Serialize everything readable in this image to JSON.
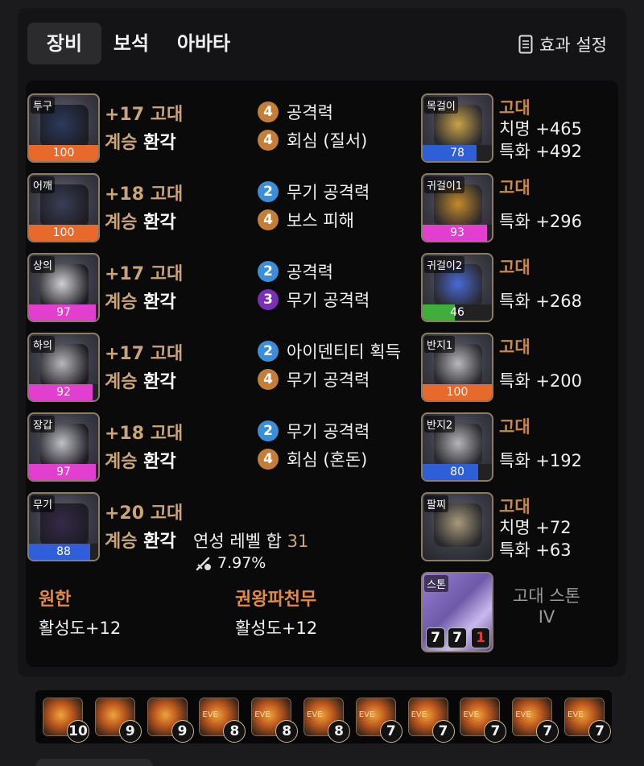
{
  "tabs": [
    "장비",
    "보석",
    "아바타"
  ],
  "effect_settings_label": "효과 설정",
  "equipment": [
    {
      "slot": "투구",
      "enhance": "+17 고대",
      "line2a": "계승",
      "line2b": "환각",
      "quality": "100",
      "quality_pct": 100,
      "quality_color": "#e8692c"
    },
    {
      "slot": "어깨",
      "enhance": "+18 고대",
      "line2a": "계승",
      "line2b": "환각",
      "quality": "100",
      "quality_pct": 100,
      "quality_color": "#e8692c"
    },
    {
      "slot": "상의",
      "enhance": "+17 고대",
      "line2a": "계승",
      "line2b": "환각",
      "quality": "97",
      "quality_pct": 97,
      "quality_color": "#e23fd0"
    },
    {
      "slot": "하의",
      "enhance": "+17 고대",
      "line2a": "계승",
      "line2b": "환각",
      "quality": "92",
      "quality_pct": 92,
      "quality_color": "#e23fd0"
    },
    {
      "slot": "장갑",
      "enhance": "+18 고대",
      "line2a": "계승",
      "line2b": "환각",
      "quality": "97",
      "quality_pct": 97,
      "quality_color": "#e23fd0"
    },
    {
      "slot": "무기",
      "enhance": "+20 고대",
      "line2a": "계승",
      "line2b": "환각",
      "quality": "88",
      "quality_pct": 88,
      "quality_color": "#2f5fd8"
    }
  ],
  "effects": [
    [
      {
        "lv": "4",
        "color": "orange",
        "name": "공격력"
      },
      {
        "lv": "4",
        "color": "orange",
        "name": "회심 (질서)"
      }
    ],
    [
      {
        "lv": "2",
        "color": "blue",
        "name": "무기 공격력"
      },
      {
        "lv": "4",
        "color": "orange",
        "name": "보스 피해"
      }
    ],
    [
      {
        "lv": "2",
        "color": "blue",
        "name": "공격력"
      },
      {
        "lv": "3",
        "color": "purple",
        "name": "무기 공격력"
      }
    ],
    [
      {
        "lv": "2",
        "color": "blue",
        "name": "아이덴티티 획득"
      },
      {
        "lv": "4",
        "color": "orange",
        "name": "무기 공격력"
      }
    ],
    [
      {
        "lv": "2",
        "color": "blue",
        "name": "무기 공격력"
      },
      {
        "lv": "4",
        "color": "orange",
        "name": "회심 (혼돈)"
      }
    ]
  ],
  "weapon_extra": {
    "level_sum_label": "연성 레벨 합",
    "level_sum_value": "31",
    "pct": "7.97%"
  },
  "accessories": [
    {
      "slot": "목걸이",
      "grade": "고대",
      "stats": [
        "치명 +465",
        "특화 +492"
      ],
      "quality": "78",
      "quality_pct": 78,
      "quality_color": "#2f5fd8"
    },
    {
      "slot": "귀걸이1",
      "grade": "고대",
      "stats": [
        "특화 +296"
      ],
      "quality": "93",
      "quality_pct": 93,
      "quality_color": "#e23fd0"
    },
    {
      "slot": "귀걸이2",
      "grade": "고대",
      "stats": [
        "특화 +268"
      ],
      "quality": "46",
      "quality_pct": 46,
      "quality_color": "#3fae3c"
    },
    {
      "slot": "반지1",
      "grade": "고대",
      "stats": [
        "특화 +200"
      ],
      "quality": "100",
      "quality_pct": 100,
      "quality_color": "#e8692c"
    },
    {
      "slot": "반지2",
      "grade": "고대",
      "stats": [
        "특화 +192"
      ],
      "quality": "80",
      "quality_pct": 80,
      "quality_color": "#2f5fd8"
    },
    {
      "slot": "팔찌",
      "grade": "고대",
      "stats": [
        "치명 +72",
        "특화 +63"
      ],
      "quality": null,
      "quality_pct": 0,
      "quality_color": ""
    }
  ],
  "stone": {
    "slot": "스톤",
    "nums": [
      "7",
      "7",
      "1"
    ],
    "label1": "고대 스톤",
    "label2": "IV"
  },
  "engravings": [
    {
      "name": "원한",
      "value": "활성도+12"
    },
    {
      "name": "권왕파천무",
      "value": "활성도+12"
    }
  ],
  "gems": [
    {
      "lv": "10",
      "eve": false
    },
    {
      "lv": "9",
      "eve": false
    },
    {
      "lv": "9",
      "eve": false
    },
    {
      "lv": "8",
      "eve": true
    },
    {
      "lv": "8",
      "eve": true
    },
    {
      "lv": "8",
      "eve": true
    },
    {
      "lv": "7",
      "eve": true
    },
    {
      "lv": "7",
      "eve": true
    },
    {
      "lv": "7",
      "eve": true
    },
    {
      "lv": "7",
      "eve": true
    },
    {
      "lv": "7",
      "eve": true
    }
  ]
}
